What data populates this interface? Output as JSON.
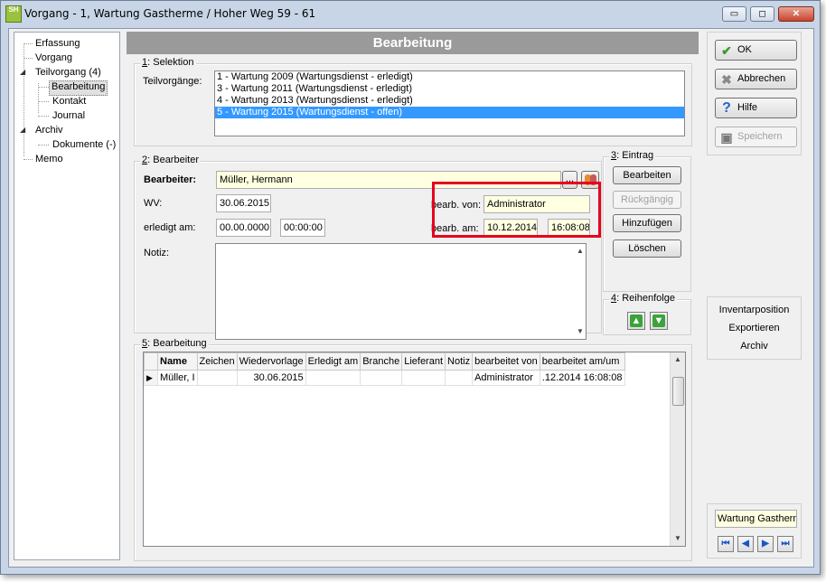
{
  "window": {
    "title": "Vorgang - 1, Wartung Gastherme / Hoher Weg 59 - 61",
    "app_icon_text": "SH",
    "buttons": {
      "minimize": "▭",
      "maximize": "◻",
      "close": "✕"
    }
  },
  "tree": {
    "items": [
      {
        "label": "Erfassung"
      },
      {
        "label": "Vorgang"
      },
      {
        "label": "Teilvorgang (4)"
      },
      {
        "label": "Bearbeitung"
      },
      {
        "label": "Kontakt"
      },
      {
        "label": "Journal"
      },
      {
        "label": "Archiv"
      },
      {
        "label": "Dokumente (-)"
      },
      {
        "label": "Memo"
      }
    ]
  },
  "main": {
    "header": "Bearbeitung",
    "selektion": {
      "group_num": "1",
      "group_title": ": Selektion",
      "label": "Teilvorgänge:",
      "items": [
        "1 - Wartung 2009 (Wartungsdienst - erledigt)",
        "3 - Wartung 2011 (Wartungsdienst - erledigt)",
        "4 - Wartung 2013 (Wartungsdienst - erledigt)",
        "5 - Wartung 2015 (Wartungsdienst - offen)"
      ]
    },
    "bearbeiter": {
      "group_num": "2",
      "group_title": ": Bearbeiter",
      "bearbeiter_label": "Bearbeiter:",
      "bearbeiter_value": "Müller, Hermann",
      "ellipsis": "...",
      "wv_label": "WV:",
      "wv_value": "30.06.2015",
      "erledigt_label": "erledigt am:",
      "erledigt_date": "00.00.0000",
      "erledigt_time": "00:00:00",
      "von_label": "bearb. von:",
      "von_value": "Administrator",
      "am_label": "bearb. am:",
      "am_date": "10.12.2014",
      "am_time": "16:08:08",
      "notiz_label": "Notiz:"
    },
    "eintrag": {
      "group_num": "3",
      "group_title": ": Eintrag",
      "bearbeiten": "Bearbeiten",
      "rueckgaengig": "Rückgängig",
      "hinzufuegen": "Hinzufügen",
      "loeschen": "Löschen"
    },
    "reihenfolge": {
      "group_num": "4",
      "group_title": ": Reihenfolge"
    },
    "bearbeitung": {
      "group_num": "5",
      "group_title": ": Bearbeitung",
      "columns": [
        "Name",
        "Zeichen",
        "Wiedervorlage",
        "Erledigt am",
        "Branche",
        "Lieferant",
        "Notiz",
        "bearbeitet von",
        "bearbeitet am/um"
      ],
      "rows": [
        [
          "Müller, I",
          "",
          "30.06.2015",
          "",
          "",
          "",
          "",
          "Administrator",
          ".12.2014 16:08:08"
        ]
      ]
    }
  },
  "right": {
    "ok": "OK",
    "abbrechen": "Abbrechen",
    "hilfe": "Hilfe",
    "speichern": "Speichern",
    "links": [
      "Inventarposition",
      "Exportieren",
      "Archiv"
    ],
    "nav_field": "Wartung Gastherme",
    "nav": {
      "first": "⏮",
      "prev": "◀",
      "next": "▶",
      "last": "⏭"
    }
  }
}
